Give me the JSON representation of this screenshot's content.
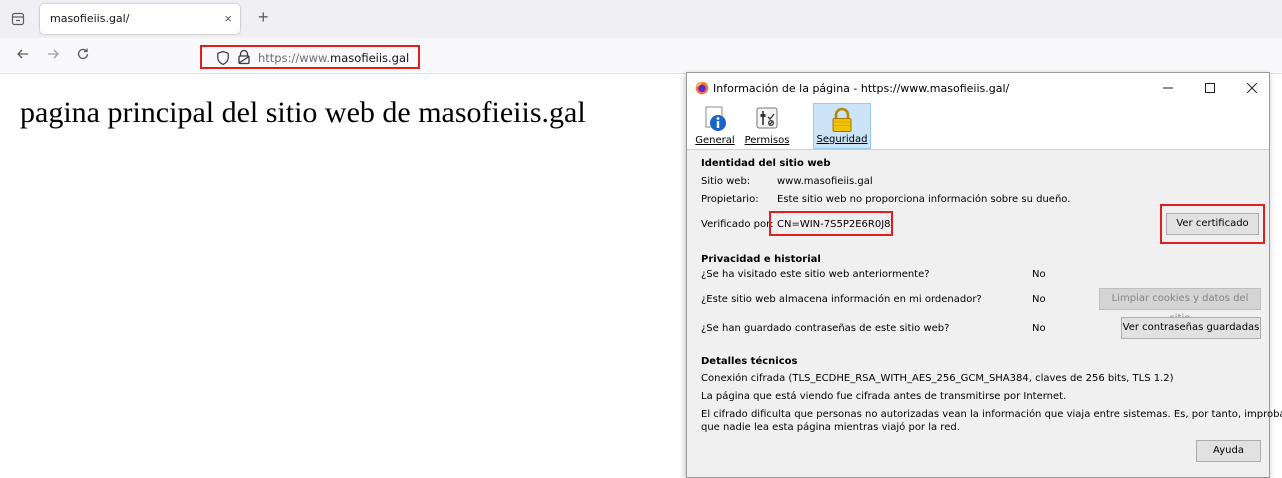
{
  "browser": {
    "tab_title": "masofieiis.gal/",
    "tab_close": "×",
    "new_tab": "+",
    "url_prefix": "https://www.",
    "url_domain": "masofieiis.gal"
  },
  "page": {
    "heading": "pagina principal del sitio web de masofieiis.gal"
  },
  "dialog": {
    "title": "Información de la página - https://www.masofieiis.gal/",
    "tabs": [
      {
        "label": "General",
        "icon": "info-icon"
      },
      {
        "label": "Permisos",
        "icon": "permissions-icon"
      },
      {
        "label": "Seguridad",
        "icon": "lock-icon",
        "active": true
      }
    ],
    "identity": {
      "heading": "Identidad del sitio web",
      "site_label": "Sitio web:",
      "site_value": "www.masofieiis.gal",
      "owner_label": "Propietario:",
      "owner_value": "Este sitio web no proporciona información sobre su dueño.",
      "verified_label": "Verificado por:",
      "verified_value": "CN=WIN-7S5P2E6R0J8",
      "view_cert_button": "Ver certificado"
    },
    "privacy": {
      "heading": "Privacidad e historial",
      "rows": [
        {
          "question": "¿Se ha visitado este sitio web anteriormente?",
          "answer": "No"
        },
        {
          "question": "¿Este sitio web almacena información en mi ordenador?",
          "answer": "No",
          "button": "Limpiar cookies y datos del sitio"
        },
        {
          "question": "¿Se han guardado contraseñas de este sitio web?",
          "answer": "No",
          "button": "Ver contraseñas guardadas"
        }
      ]
    },
    "technical": {
      "heading": "Detalles técnicos",
      "line1": "Conexión cifrada (TLS_ECDHE_RSA_WITH_AES_256_GCM_SHA384, claves de 256 bits, TLS 1.2)",
      "line2": "La página que está viendo fue cifrada antes de transmitirse por Internet.",
      "line3": "El cifrado dificulta que personas no autorizadas vean la información que viaja entre sistemas. Es, por tanto, improbable",
      "line4": "que nadie lea esta página mientras viajó por la red."
    },
    "help_button": "Ayuda"
  },
  "colors": {
    "highlight": "#e02020",
    "active_tab_bg": "#cce4f7"
  }
}
